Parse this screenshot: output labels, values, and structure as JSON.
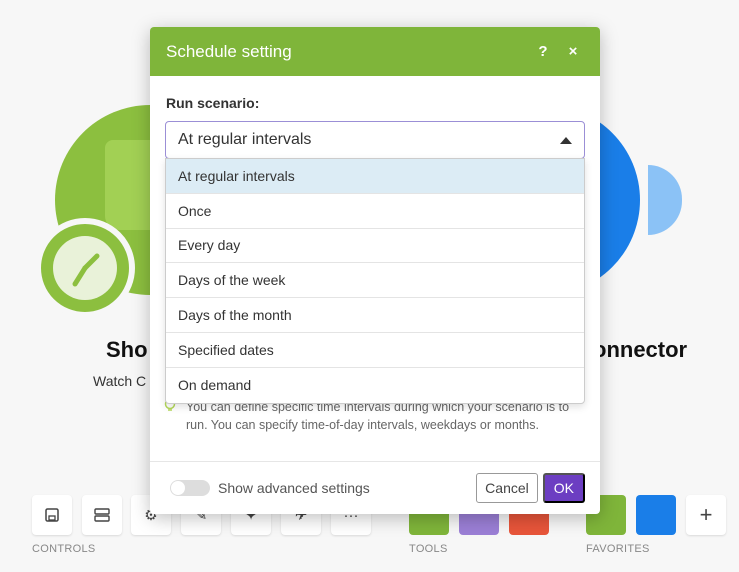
{
  "modal": {
    "title": "Schedule setting",
    "help_icon": "?",
    "close_icon": "×",
    "run_label": "Run scenario:",
    "selected_value": "At regular intervals",
    "options": [
      "At regular intervals",
      "Once",
      "Every day",
      "Days of the week",
      "Days of the month",
      "Specified dates",
      "On demand"
    ],
    "hint": "You can define specific time intervals during which your scenario is to run. You can specify time-of-day intervals, weekdays or months.",
    "advanced_label": "Show advanced settings",
    "cancel_label": "Cancel",
    "ok_label": "OK",
    "colors": {
      "header": "#7fb53a",
      "ok": "#6c3ec2"
    }
  },
  "canvas": {
    "node1_title": "Sho",
    "node1_sub": "Watch C",
    "node2_title": "onnector"
  },
  "toolbar": {
    "controls_label": "CONTROLS",
    "tools_label": "TOOLS",
    "favorites_label": "FAVORITES",
    "more_icon": "···",
    "plus_icon": "+"
  }
}
